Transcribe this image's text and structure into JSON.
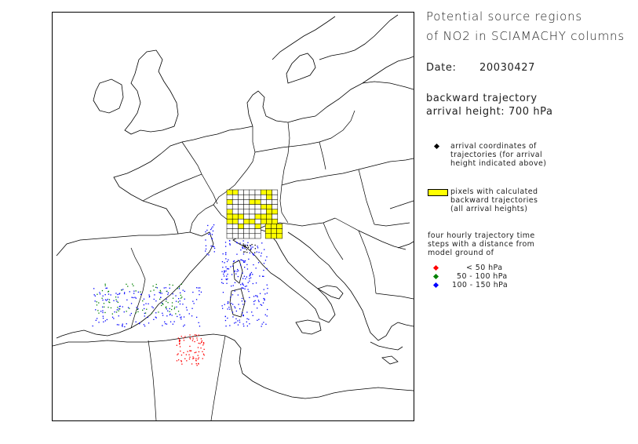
{
  "title": {
    "line1": "Potential source regions",
    "line2": "of NO2 in SCIAMACHY columns"
  },
  "date": {
    "label": "Date:",
    "value": "20030427"
  },
  "trajectory": {
    "line1": "backward trajectory",
    "line2": "arrival height: 700 hPa"
  },
  "legend": {
    "arrival": {
      "lines": [
        "arrival coordinates of",
        "trajectories (for arrival",
        "height indicated above)"
      ],
      "color": "#000000"
    },
    "pixels": {
      "lines": [
        "pixels with calculated",
        "backward trajectories",
        "(all arrival heights)"
      ],
      "color": "#ffff00"
    },
    "steps_intro": [
      "four hourly trajectory time",
      "steps with a distance from",
      "model ground of"
    ],
    "steps": [
      {
        "label": "<  50 hPa",
        "color": "#ff0000"
      },
      {
        "label": "50 - 100 hPa",
        "color": "#008000"
      },
      {
        "label": "100 - 150 hPa",
        "color": "#0000ff"
      }
    ]
  },
  "map": {
    "region": "Europe",
    "coastline_color": "#000000",
    "grid_color": "#000000",
    "highlight_color": "#ffff00"
  }
}
